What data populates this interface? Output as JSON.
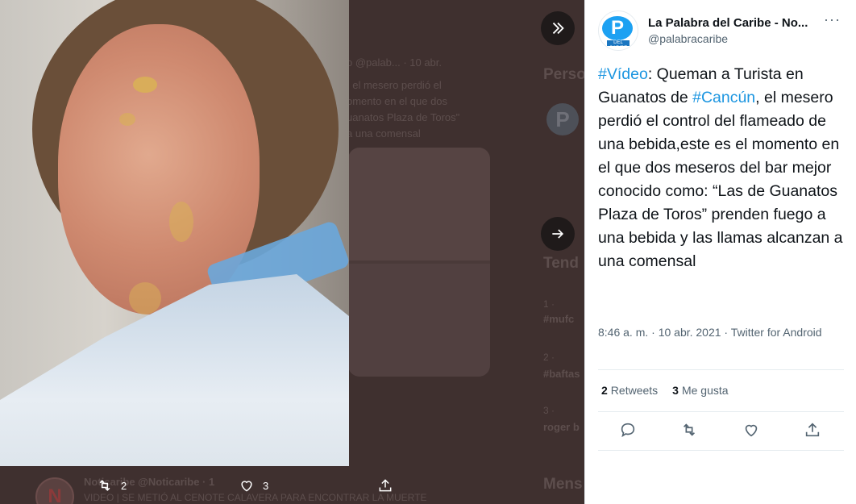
{
  "background": {
    "timeline_text": [
      "o @palab...",
      "· 10 abr.",
      ", el mesero perdió el",
      "omento en el que dos",
      "uanatos Plaza de Toros\"",
      "a una comensal"
    ],
    "sidebar": {
      "people_heading": "Perso",
      "trends_heading": "Tend",
      "trend1_rank": "1 ·",
      "trend1_tag": "#mufc",
      "trend2_rank": "2 ·",
      "trend2_tag": "#baftas",
      "trend3_rank": "3 ·",
      "trend3_tag": "roger b",
      "messages_heading": "Mens"
    },
    "bottom_tweet": {
      "avatar_letter": "N",
      "author": "Noticaribe @Noticaribe · 1",
      "text": "VIDEO | SE METIÓ AL CENOTE CALAVERA PARA ENCONTRAR LA MUERTE"
    }
  },
  "overlay_actions": {
    "retweet_count": "2",
    "like_count": "3"
  },
  "tweet": {
    "author_name": "La Palabra del Caribe - No...",
    "handle": "@palabracaribe",
    "logo_letter": "P",
    "logo_sub": "DEL CARIBE",
    "more_label": "···",
    "text_parts": {
      "hashtag1": "#Vídeo",
      "part1": ": Queman a Turista en Guanatos de ",
      "hashtag2": "#Cancún",
      "part2": ", el mesero perdió el control del flameado de una bebida,este es el momento en el que dos meseros del bar mejor conocido como: “Las de Guanatos Plaza de Toros” prenden fuego a una bebida y las llamas alcanzan a una comensal"
    },
    "meta": "8:46 a. m. · 10 abr. 2021 · Twitter for Android",
    "stats": {
      "retweets_count": "2",
      "retweets_label": "Retweets",
      "likes_count": "3",
      "likes_label": "Me gusta"
    }
  },
  "icons": {
    "collapse": "chevrons-right-icon",
    "next": "arrow-right-icon",
    "reply": "reply-icon",
    "retweet": "retweet-icon",
    "like": "heart-icon",
    "share": "share-icon"
  },
  "colors": {
    "accent": "#1b95e0",
    "text": "#0f1419",
    "muted": "#536471"
  }
}
